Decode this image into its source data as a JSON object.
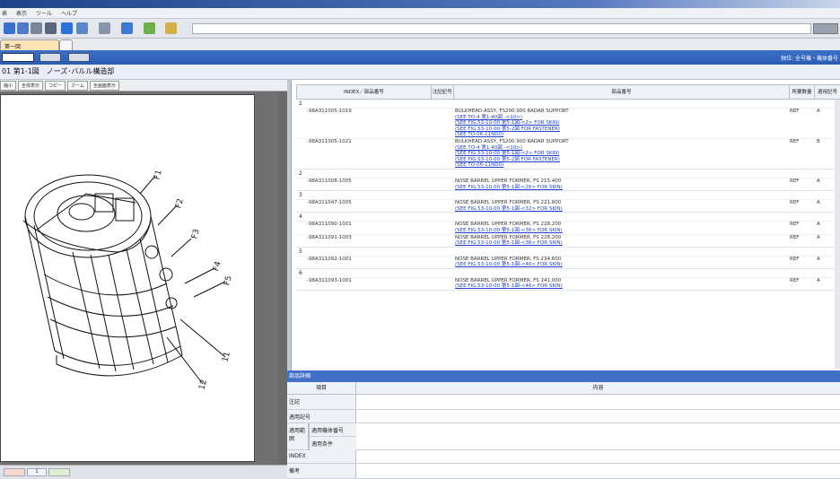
{
  "menubar": {
    "items": [
      "表",
      "表示",
      "ツール",
      "ヘルプ"
    ]
  },
  "tabs": [
    {
      "label": "第一図"
    },
    {
      "label": ""
    }
  ],
  "navbar": {
    "right_text": "独位: 全号機・機体番号"
  },
  "breadcrumb": {
    "text": "01 第1-1図　ノーズ･バルル構造部"
  },
  "left_toolbar": {
    "buttons": [
      "縮小",
      "全体表示",
      "コピー",
      "ズーム",
      "全画面表示"
    ]
  },
  "figure": {
    "callouts": [
      "F1",
      "F2",
      "F3",
      "F4",
      "F5",
      "11",
      "12"
    ]
  },
  "parts_table": {
    "headers": [
      "INDEX／部品番号",
      "注記記号",
      "部品番号",
      "所要数量",
      "適用記号"
    ],
    "groups": [
      {
        "num": "1",
        "rows": [
          {
            "pn": "-98A311005-1019",
            "desc": [
              "BULKHEAD ASSY, FS200.900 RADAR SUPPORT",
              "(SEE TO-4 第1-40図 -<10>)",
              "(SEE FIG.53-10-00 第5-1図-<2> FOR SKIN)",
              "(SEE FIG.53-10-00 第5-2図 FOR FASTENER)",
              "(SEE TO-06-11ND0)"
            ],
            "ref": "REF",
            "ap": "A"
          },
          {
            "pn": "-98A311005-1021",
            "desc": [
              "BULKHEAD ASSY, FS200.900 RADAR SUPPORT",
              "(SEE TO-4 第1-40図 -<10>)",
              "(SEE FIG.53-10-00 第5-1図-<2> FOR SKIN)",
              "(SEE FIG.53-10-00 第5-2図 FOR FASTENER)",
              "(SEE TO-06-11ND0)"
            ],
            "ref": "REF",
            "ap": "B"
          }
        ]
      },
      {
        "num": "2",
        "rows": [
          {
            "pn": "-98A311008-1005",
            "desc": [
              "NOSE BARREL UPPER FORMER, FS 215.400",
              "(SEE FIG.53-10-00 第5-1図-<26> FOR SKIN)"
            ],
            "ref": "REF",
            "ap": "A"
          }
        ]
      },
      {
        "num": "3",
        "rows": [
          {
            "pn": "-98A311047-1005",
            "desc": [
              "NOSE BARREL UPPER FORMER, FS 221.800",
              "(SEE FIG.53-10-00 第5-1図-<32> FOR SKIN)"
            ],
            "ref": "REF",
            "ap": "A"
          }
        ]
      },
      {
        "num": "4",
        "rows": [
          {
            "pn": "-98A311090-1001",
            "desc": [
              "NOSE BARREL UPPER FORMER, FS 228.200",
              "(SEE FIG.53-10-00 第5-1図-<36> FOR SKIN)"
            ],
            "ref": "REF",
            "ap": "A"
          },
          {
            "pn": "-98A311091-1003",
            "desc": [
              "NOSE BARREL UPPER FORMER, FS 228.200",
              "(SEE FIG.53-10-00 第5-1図-<36> FOR SKIN)"
            ],
            "ref": "REF",
            "ap": "A"
          }
        ]
      },
      {
        "num": "5",
        "rows": [
          {
            "pn": "-98A311092-1001",
            "desc": [
              "NOSE BARREL UPPER FORMER, FS 234.600",
              "(SEE FIG.53-10-00 第5-1図-<40> FOR SKIN)"
            ],
            "ref": "REF",
            "ap": "A"
          }
        ]
      },
      {
        "num": "6",
        "rows": [
          {
            "pn": "-98A311093-1001",
            "desc": [
              "NOSE BARREL UPPER FORMER, FS 241.000",
              "(SEE FIG.53-10-00 第5-1図-<46> FOR SKIN)"
            ],
            "ref": "REF",
            "ap": "A"
          }
        ]
      }
    ]
  },
  "detail": {
    "bar_title": "部品詳細",
    "headers": [
      "項目",
      "内容"
    ],
    "rows": [
      "注記",
      "適用記号",
      "適用範囲",
      "INDEX",
      "備考"
    ],
    "sublabels": [
      "適用機体番号",
      "適用条件"
    ]
  },
  "statusbar": {
    "page": "1"
  }
}
